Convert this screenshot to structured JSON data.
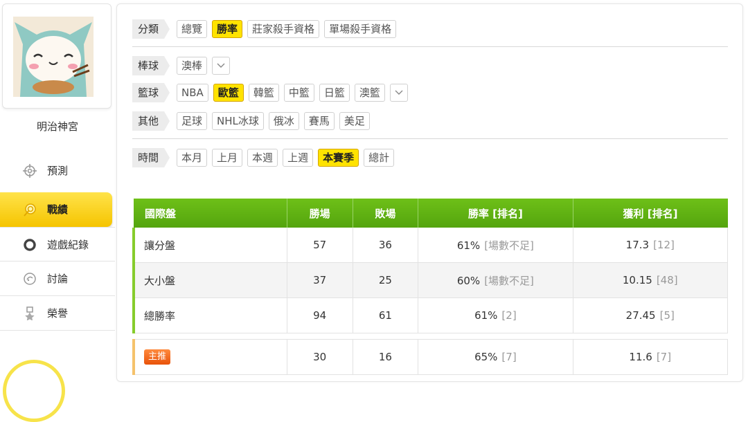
{
  "user": {
    "name": "明治神宮"
  },
  "nav": {
    "predict": "預測",
    "record": "戰績",
    "games": "遊戲紀錄",
    "discuss": "討論",
    "honor": "榮譽"
  },
  "filters": {
    "category": {
      "label": "分類",
      "options": [
        "總覽",
        "勝率",
        "莊家殺手資格",
        "單場殺手資格"
      ],
      "selected": "勝率"
    },
    "baseball": {
      "label": "棒球",
      "options": [
        "澳棒"
      ]
    },
    "basketball": {
      "label": "籃球",
      "options": [
        "NBA",
        "歐籃",
        "韓籃",
        "中籃",
        "日籃",
        "澳籃"
      ],
      "selected": "歐籃"
    },
    "other": {
      "label": "其他",
      "options": [
        "足球",
        "NHL冰球",
        "俄冰",
        "賽馬",
        "美足"
      ]
    },
    "time": {
      "label": "時間",
      "options": [
        "本月",
        "上月",
        "本週",
        "上週",
        "本賽季",
        "總計"
      ],
      "selected": "本賽季"
    }
  },
  "table": {
    "headers": [
      "國際盤",
      "勝場",
      "敗場",
      "勝率 [排名]",
      "獲利 [排名]"
    ],
    "rows": [
      {
        "name": "讓分盤",
        "wins": "57",
        "losses": "36",
        "rate": "61%",
        "rate_rank": "[場數不足]",
        "profit": "17.3",
        "profit_rank": "[12]"
      },
      {
        "name": "大小盤",
        "wins": "37",
        "losses": "25",
        "rate": "60%",
        "rate_rank": "[場數不足]",
        "profit": "10.15",
        "profit_rank": "[48]"
      },
      {
        "name": "總勝率",
        "wins": "94",
        "losses": "61",
        "rate": "61%",
        "rate_rank": "[2]",
        "profit": "27.45",
        "profit_rank": "[5]"
      }
    ],
    "main_pick": {
      "badge": "主推",
      "wins": "30",
      "losses": "16",
      "rate": "65%",
      "rate_rank": "[7]",
      "profit": "11.6",
      "profit_rank": "[7]"
    }
  },
  "colors": {
    "accent_yellow": "#ffe300",
    "header_green": "#5fb214",
    "badge_orange": "#f06a1c"
  },
  "icons": [
    "avatar-cat-image",
    "crosshair-icon",
    "target-icon",
    "circle-icon",
    "chat-icon",
    "trophy-icon",
    "chevron-down-icon"
  ]
}
